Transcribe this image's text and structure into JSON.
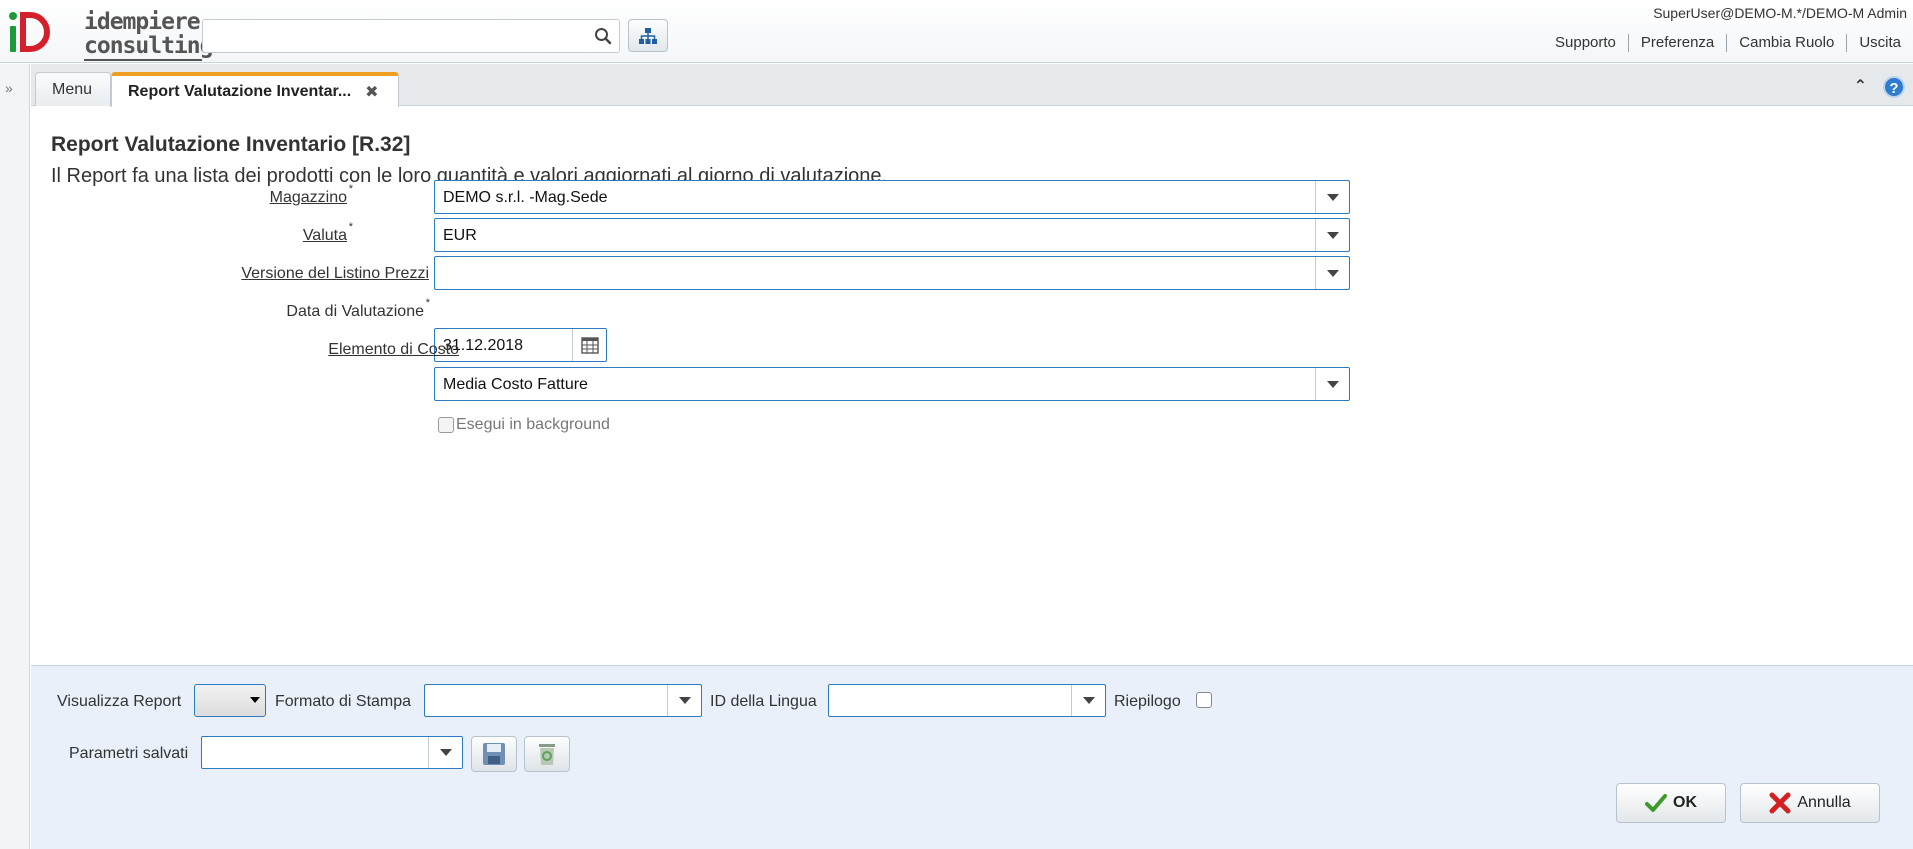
{
  "header": {
    "logo_text_line1": "idempiere",
    "logo_text_line2": "consulting",
    "search_placeholder": "",
    "user": "SuperUser@DEMO-M.*/DEMO-M Admin",
    "links": [
      "Supporto",
      "Preferenza",
      "Cambia Ruolo",
      "Uscita"
    ]
  },
  "tabs": {
    "menu_label": "Menu",
    "active_label": "Report Valutazione Inventar..."
  },
  "report": {
    "title": "Report Valutazione Inventario [R.32]",
    "description": "Il Report fa una lista dei prodotti con le loro quantità e valori aggiornati al giorno di valutazione."
  },
  "fields": {
    "magazzino": {
      "label": "Magazzino",
      "value": "DEMO s.r.l. -Mag.Sede"
    },
    "valuta": {
      "label": "Valuta",
      "value": "EUR"
    },
    "versione_listino": {
      "label": "Versione del Listino Prezzi",
      "value": ""
    },
    "data_valutazione": {
      "label": "Data di Valutazione",
      "value": "31.12.2018"
    },
    "elemento_costo": {
      "label": "Elemento di Costo",
      "value": "Media Costo Fatture"
    },
    "background": {
      "label": "Esegui in background",
      "checked": false
    }
  },
  "bottom": {
    "visualizza_report_label": "Visualizza Report",
    "formato_stampa_label": "Formato di Stampa",
    "id_lingua_label": "ID della Lingua",
    "riepilogo_label": "Riepilogo",
    "parametri_salvati_label": "Parametri salvati",
    "ok_label": "OK",
    "annulla_label": "Annulla"
  },
  "colors": {
    "accent_blue": "#2c7bc0",
    "tab_highlight": "#f0a020",
    "logo_green": "#1d9b3b",
    "logo_red": "#d4202c"
  }
}
